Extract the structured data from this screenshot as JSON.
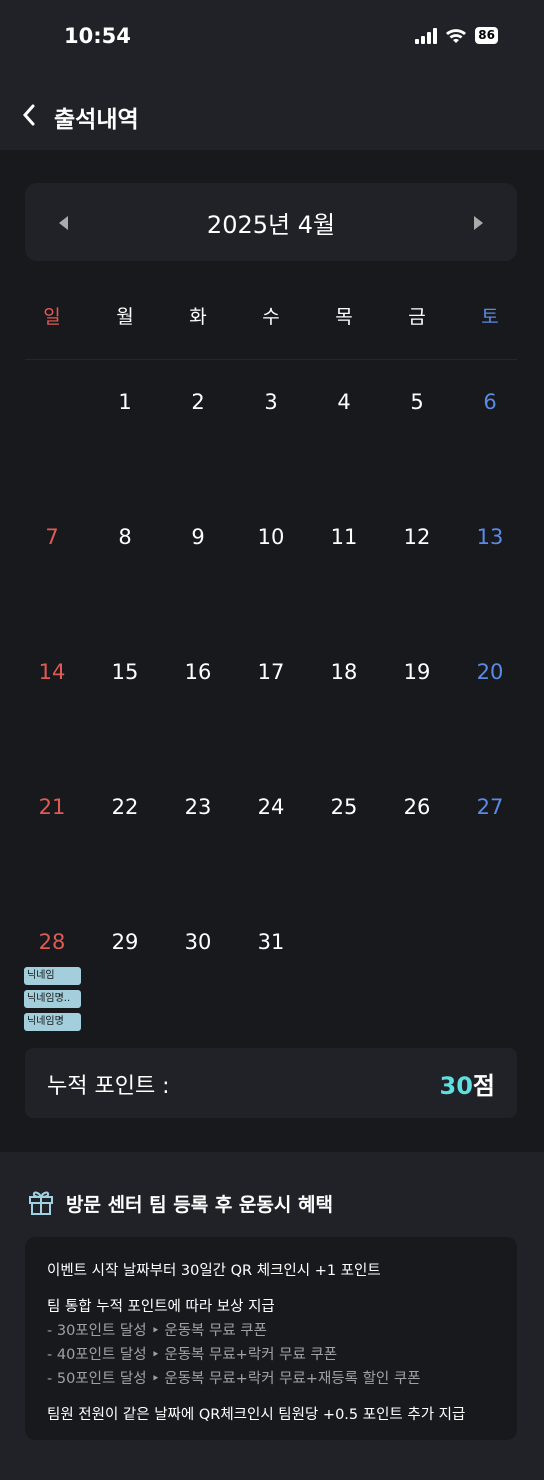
{
  "status": {
    "time": "10:54",
    "battery": "86"
  },
  "header": {
    "title": "출석내역"
  },
  "calendar": {
    "month_title": "2025년 4월",
    "weekdays": [
      "일",
      "월",
      "화",
      "수",
      "목",
      "금",
      "토"
    ],
    "weeks": [
      [
        null,
        1,
        2,
        3,
        4,
        5,
        6
      ],
      [
        7,
        8,
        9,
        10,
        11,
        12,
        13
      ],
      [
        14,
        15,
        16,
        17,
        18,
        19,
        20
      ],
      [
        21,
        22,
        23,
        24,
        25,
        26,
        27
      ],
      [
        28,
        29,
        30,
        31,
        null,
        null,
        null
      ]
    ],
    "events": {
      "14": [
        "닉네임",
        "닉네임명..",
        "닉네임명"
      ]
    },
    "colors": {
      "sunday": "#e05a55",
      "saturday": "#5b8ae6",
      "event": "#a3cfdc"
    }
  },
  "points": {
    "label": "누적 포인트 :",
    "value": "30",
    "unit": "점",
    "accent": "#5ee0e0"
  },
  "benefit": {
    "title": "방문 센터 팀 등록 후 운동시 혜택",
    "line1": "이벤트 시작 날짜부터 30일간 QR 체크인시 +1 포인트",
    "line2": "팀 통합 누적 포인트에 따라 보상 지급",
    "rewards": [
      "- 30포인트 달성 ‣ 운동복 무료 쿠폰",
      "- 40포인트 달성 ‣ 운동복 무료+락커 무료 쿠폰",
      "- 50포인트 달성 ‣ 운동복 무료+락커 무료+재등록 할인 쿠폰"
    ],
    "line3": "팀원 전원이 같은 날짜에 QR체크인시 팀원당 +0.5 포인트 추가 지급"
  }
}
